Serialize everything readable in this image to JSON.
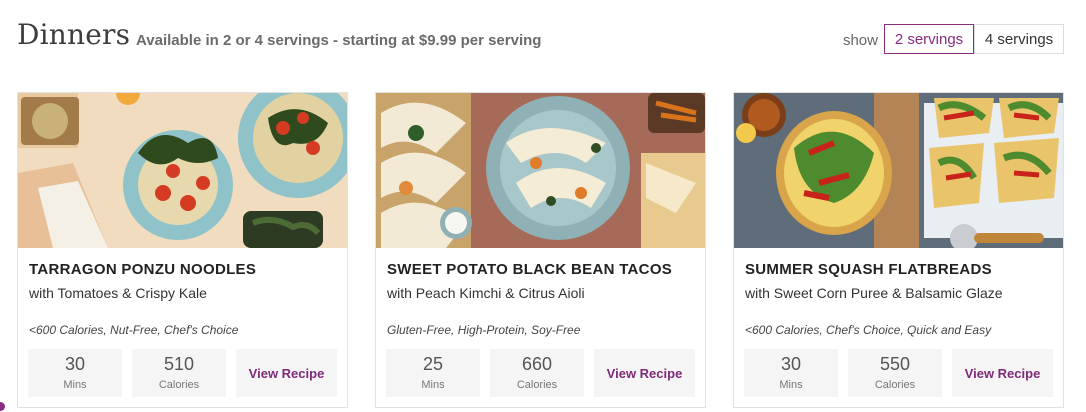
{
  "header": {
    "title": "Dinners",
    "subtitle": "Available in 2 or 4 servings - starting at $9.99 per serving",
    "show_label": "show",
    "servings": [
      {
        "label": "2 servings",
        "active": true
      },
      {
        "label": "4 servings",
        "active": false
      }
    ]
  },
  "colors": {
    "accent": "#8b2c83"
  },
  "recipes": [
    {
      "name": "TARRAGON PONZU NOODLES",
      "subtitle": "with Tomatoes & Crispy Kale",
      "tags": "<600 Calories, Nut-Free, Chef's Choice",
      "time": "30",
      "time_unit": "Mins",
      "calories": "510",
      "calories_unit": "Calories",
      "cta": "View Recipe"
    },
    {
      "name": "SWEET POTATO BLACK BEAN TACOS",
      "subtitle": "with Peach Kimchi & Citrus Aioli",
      "tags": "Gluten-Free, High-Protein, Soy-Free",
      "time": "25",
      "time_unit": "Mins",
      "calories": "660",
      "calories_unit": "Calories",
      "cta": "View Recipe"
    },
    {
      "name": "SUMMER SQUASH FLATBREADS",
      "subtitle": "with Sweet Corn Puree & Balsamic Glaze",
      "tags": "<600 Calories, Chef's Choice, Quick and Easy",
      "time": "30",
      "time_unit": "Mins",
      "calories": "550",
      "calories_unit": "Calories",
      "cta": "View Recipe"
    }
  ]
}
